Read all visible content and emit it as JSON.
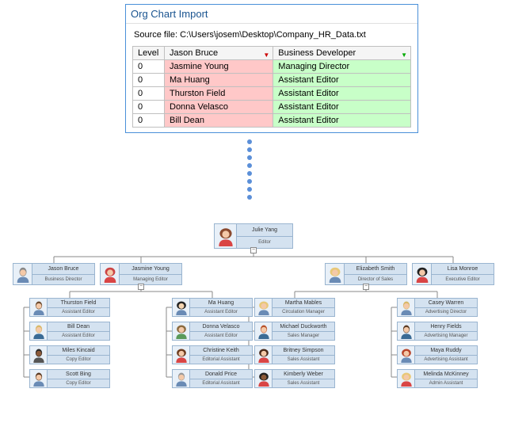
{
  "window": {
    "title": "Org Chart Import",
    "source_file_label": "Source file: C:\\Users\\josem\\Desktop\\Company_HR_Data.txt"
  },
  "table": {
    "headers": {
      "level": "Level",
      "name": "Jason Bruce",
      "role": "Business Developer"
    },
    "rows": [
      {
        "level": "0",
        "name": "Jasmine Young",
        "role": "Managing Director"
      },
      {
        "level": "0",
        "name": "Ma Huang",
        "role": "Assistant Editor"
      },
      {
        "level": "0",
        "name": "Thurston Field",
        "role": "Assistant Editor"
      },
      {
        "level": "0",
        "name": "Donna Velasco",
        "role": "Assistant Editor"
      },
      {
        "level": "0",
        "name": "Bill Dean",
        "role": "Assistant Editor"
      }
    ]
  },
  "chart_data": {
    "type": "tree",
    "root": {
      "name": "Julie Yang",
      "role": "Editor",
      "avatar": "female-brunette"
    },
    "level1": [
      {
        "name": "Jason Bruce",
        "role": "Business Director",
        "avatar": "male-gray"
      },
      {
        "name": "Jasmine Young",
        "role": "Managing Editor",
        "avatar": "female-red"
      },
      {
        "name": "Elizabeth Smith",
        "role": "Director of Sales",
        "avatar": "female-blonde"
      },
      {
        "name": "Lisa Monroe",
        "role": "Executive Editor",
        "avatar": "female-black"
      }
    ],
    "level2": {
      "col0": [
        {
          "name": "Thurston Field",
          "role": "Assistant Editor",
          "avatar": "male-brown"
        },
        {
          "name": "Bill Dean",
          "role": "Assistant Editor",
          "avatar": "male-blonde"
        },
        {
          "name": "Miles Kincaid",
          "role": "Copy Editor",
          "avatar": "male-dark"
        },
        {
          "name": "Scott Bing",
          "role": "Copy Editor",
          "avatar": "male-brown2"
        }
      ],
      "col1": [
        {
          "name": "Ma Huang",
          "role": "Assistant Editor",
          "avatar": "female-asian"
        },
        {
          "name": "Donna Velasco",
          "role": "Assistant Editor",
          "avatar": "female-green"
        },
        {
          "name": "Christine Keith",
          "role": "Editorial Assistant",
          "avatar": "female-brown"
        },
        {
          "name": "Donald Price",
          "role": "Editorial Assistant",
          "avatar": "male-gray2"
        }
      ],
      "col2": [
        {
          "name": "Martha Mables",
          "role": "Circulation Manager",
          "avatar": "female-blonde2"
        },
        {
          "name": "Michael Duckworth",
          "role": "Sales Manager",
          "avatar": "male-red"
        },
        {
          "name": "Britney Simpson",
          "role": "Sales Assistant",
          "avatar": "female-brunette2"
        },
        {
          "name": "Kimberly Weber",
          "role": "Sales Assistant",
          "avatar": "female-dark"
        }
      ],
      "col3": [
        {
          "name": "Casey Warren",
          "role": "Advertising Director",
          "avatar": "male-blonde2"
        },
        {
          "name": "Henry Fields",
          "role": "Advertising Manager",
          "avatar": "male-brown3"
        },
        {
          "name": "Maya Ruddy",
          "role": "Advertising Assistant",
          "avatar": "female-red2"
        },
        {
          "name": "Melinda McKinney",
          "role": "Admin Assistant",
          "avatar": "female-blonde3"
        }
      ]
    }
  },
  "avatars": {
    "female-brunette": {
      "hair": "#8b4a2e",
      "skin": "#f4c9a8",
      "body": "#d94545"
    },
    "male-gray": {
      "hair": "#888",
      "skin": "#f4c9a8",
      "body": "#6a8bb5"
    },
    "female-red": {
      "hair": "#c44",
      "skin": "#f4c9a8",
      "body": "#d94545"
    },
    "female-blonde": {
      "hair": "#e8c878",
      "skin": "#f4c9a8",
      "body": "#6a8bb5"
    },
    "female-black": {
      "hair": "#222",
      "skin": "#f4c9a8",
      "body": "#d94545"
    },
    "male-brown": {
      "hair": "#6b4a2e",
      "skin": "#f4c9a8",
      "body": "#6a8bb5"
    },
    "male-blonde": {
      "hair": "#d8b868",
      "skin": "#f4c9a8",
      "body": "#3a6b95"
    },
    "male-dark": {
      "hair": "#2a2a2a",
      "skin": "#8b5a3a",
      "body": "#555"
    },
    "male-brown2": {
      "hair": "#5a3a22",
      "skin": "#f4c9a8",
      "body": "#6a8bb5"
    },
    "female-asian": {
      "hair": "#222",
      "skin": "#f4d4b0",
      "body": "#6a8bb5"
    },
    "female-green": {
      "hair": "#8b6a3e",
      "skin": "#f4c9a8",
      "body": "#5a9a5a"
    },
    "female-brown": {
      "hair": "#6b3a1e",
      "skin": "#f4c9a8",
      "body": "#d94545"
    },
    "male-gray2": {
      "hair": "#999",
      "skin": "#f4c9a8",
      "body": "#6a8bb5"
    },
    "female-blonde2": {
      "hair": "#e8c878",
      "skin": "#f4c9a8",
      "body": "#6a8bb5"
    },
    "male-red": {
      "hair": "#b8522a",
      "skin": "#f4c9a8",
      "body": "#3a6b95"
    },
    "female-brunette2": {
      "hair": "#4a2a1a",
      "skin": "#f4c9a8",
      "body": "#d94545"
    },
    "female-dark": {
      "hair": "#222",
      "skin": "#8b5a3a",
      "body": "#d94545"
    },
    "male-blonde2": {
      "hair": "#d8b868",
      "skin": "#f4c9a8",
      "body": "#6a8bb5"
    },
    "male-brown3": {
      "hair": "#5a3a22",
      "skin": "#f4c9a8",
      "body": "#3a6b95"
    },
    "female-red2": {
      "hair": "#b8442a",
      "skin": "#f4c9a8",
      "body": "#6a8bb5"
    },
    "female-blonde3": {
      "hair": "#e8c878",
      "skin": "#f4c9a8",
      "body": "#d94545"
    }
  }
}
